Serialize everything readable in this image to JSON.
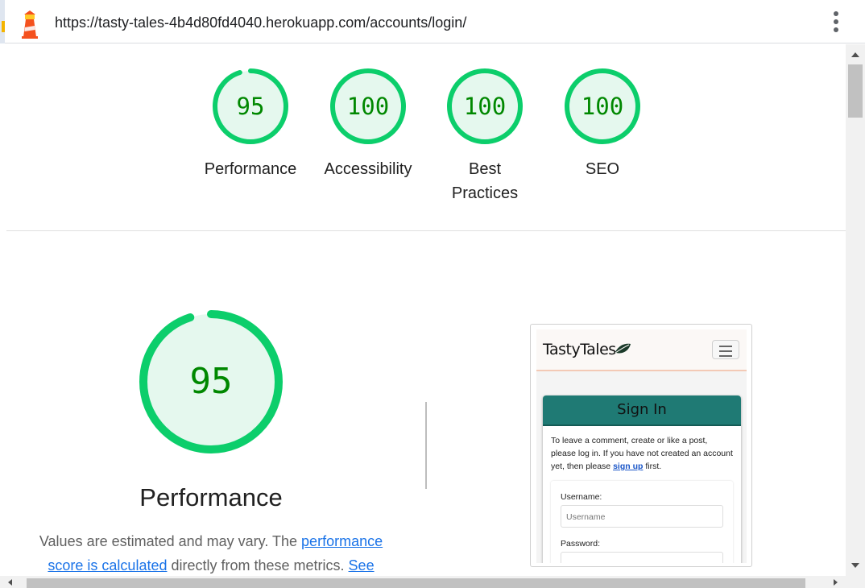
{
  "browser": {
    "url": "https://tasty-tales-4b4d80fd4040.herokuapp.com/accounts/login/",
    "lighthouse_icon": "lighthouse-icon",
    "menu_icon": "kebab-menu-icon"
  },
  "colors": {
    "pass_green": "#0cce6b",
    "pass_fill": "#e5f8ee",
    "pass_text": "#008800",
    "link": "#1a73e8"
  },
  "scores": [
    {
      "score": "95",
      "label": "Performance",
      "percent": 95
    },
    {
      "score": "100",
      "label": "Accessibility",
      "percent": 100
    },
    {
      "score": "100",
      "label": "Best Practices",
      "percent": 100
    },
    {
      "score": "100",
      "label": "SEO",
      "percent": 100
    }
  ],
  "performance": {
    "score": "95",
    "percent": 95,
    "title": "Performance",
    "desc_start": "Values are estimated and may vary. The ",
    "desc_link1": "performance score is calculated",
    "desc_mid": " directly from these metrics. ",
    "desc_link2": "See"
  },
  "screenshot": {
    "brand": "TastyTales",
    "brand_icon": "leaf-icon",
    "menu_icon": "hamburger-icon",
    "card_title": "Sign In",
    "intro_1": "To leave a comment, create or like a post, please log in. If you have not created an account yet, then please ",
    "signup_link": "sign up",
    "intro_2": " first.",
    "username_label": "Username:",
    "username_placeholder": "Username",
    "password_label": "Password:"
  }
}
